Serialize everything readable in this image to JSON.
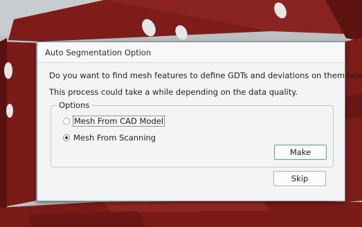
{
  "dialog": {
    "title": "Auto Segmentation Option",
    "prompt_line1": "Do you want to find mesh features to define GDTs and deviations on them later?",
    "prompt_line2": "This process could take a while depending on the data quality.",
    "options_label": "Options",
    "options": [
      {
        "label": "Mesh From CAD Model",
        "selected": false
      },
      {
        "label": "Mesh From Scanning",
        "selected": true
      }
    ],
    "make_label": "Make",
    "skip_label": "Skip"
  },
  "colors": {
    "part_red": "#7d1c19",
    "background_gray": "#bfc3c6",
    "dialog_border": "#6f8f8a"
  }
}
